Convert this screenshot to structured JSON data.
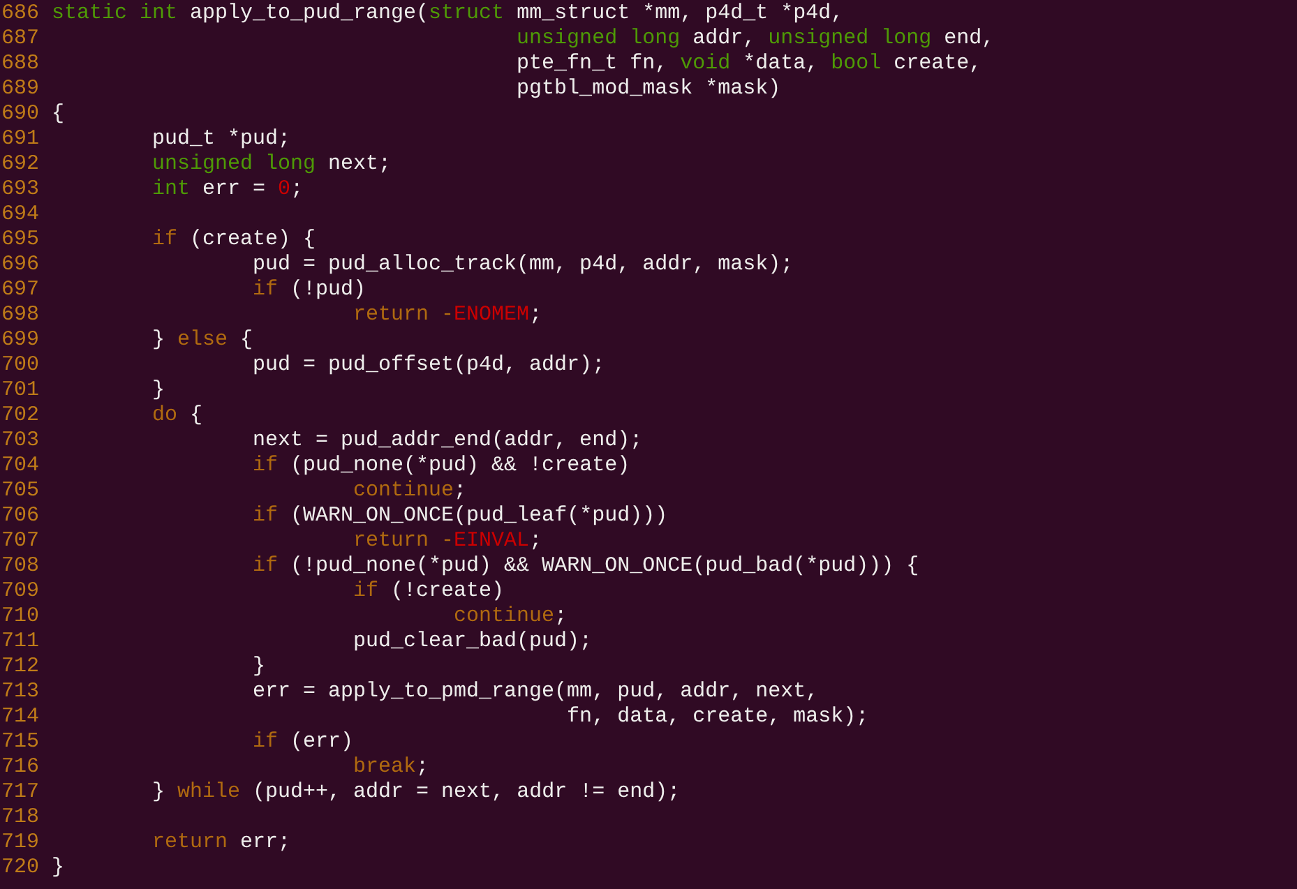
{
  "editor": {
    "lines": [
      {
        "number": "686",
        "segments": [
          {
            "kind": "type",
            "text": "static int"
          },
          {
            "kind": "plain",
            "text": " apply_to_pud_range("
          },
          {
            "kind": "type",
            "text": "struct"
          },
          {
            "kind": "plain",
            "text": " mm_struct *mm, p4d_t *p4d,"
          }
        ]
      },
      {
        "number": "687",
        "segments": [
          {
            "kind": "type",
            "text": "                                     unsigned long"
          },
          {
            "kind": "plain",
            "text": " addr, "
          },
          {
            "kind": "type",
            "text": "unsigned long"
          },
          {
            "kind": "plain",
            "text": " end,"
          }
        ]
      },
      {
        "number": "688",
        "segments": [
          {
            "kind": "plain",
            "text": "                                     pte_fn_t fn, "
          },
          {
            "kind": "type",
            "text": "void"
          },
          {
            "kind": "plain",
            "text": " *data, "
          },
          {
            "kind": "type",
            "text": "bool"
          },
          {
            "kind": "plain",
            "text": " create,"
          }
        ]
      },
      {
        "number": "689",
        "segments": [
          {
            "kind": "plain",
            "text": "                                     pgtbl_mod_mask *mask)"
          }
        ]
      },
      {
        "number": "690",
        "segments": [
          {
            "kind": "plain",
            "text": "{"
          }
        ]
      },
      {
        "number": "691",
        "segments": [
          {
            "kind": "plain",
            "text": "        pud_t *pud;"
          }
        ]
      },
      {
        "number": "692",
        "segments": [
          {
            "kind": "type",
            "text": "        unsigned long"
          },
          {
            "kind": "plain",
            "text": " next;"
          }
        ]
      },
      {
        "number": "693",
        "segments": [
          {
            "kind": "type",
            "text": "        int"
          },
          {
            "kind": "plain",
            "text": " err = "
          },
          {
            "kind": "constant",
            "text": "0"
          },
          {
            "kind": "plain",
            "text": ";"
          }
        ]
      },
      {
        "number": "694"
      },
      {
        "number": "695",
        "segments": [
          {
            "kind": "keyword",
            "text": "        if"
          },
          {
            "kind": "plain",
            "text": " (create) {"
          }
        ]
      },
      {
        "number": "696",
        "segments": [
          {
            "kind": "plain",
            "text": "                pud = pud_alloc_track(mm, p4d, addr, mask);"
          }
        ]
      },
      {
        "number": "697",
        "segments": [
          {
            "kind": "keyword",
            "text": "                if"
          },
          {
            "kind": "plain",
            "text": " (!pud)"
          }
        ]
      },
      {
        "number": "698",
        "segments": [
          {
            "kind": "keyword",
            "text": "                        return -"
          },
          {
            "kind": "constant",
            "text": "ENOMEM"
          },
          {
            "kind": "plain",
            "text": ";"
          }
        ]
      },
      {
        "number": "699",
        "segments": [
          {
            "kind": "plain",
            "text": "        } "
          },
          {
            "kind": "keyword",
            "text": "else"
          },
          {
            "kind": "plain",
            "text": " {"
          }
        ]
      },
      {
        "number": "700",
        "segments": [
          {
            "kind": "plain",
            "text": "                pud = pud_offset(p4d, addr);"
          }
        ]
      },
      {
        "number": "701",
        "segments": [
          {
            "kind": "plain",
            "text": "        }"
          }
        ]
      },
      {
        "number": "702",
        "segments": [
          {
            "kind": "keyword",
            "text": "        do"
          },
          {
            "kind": "plain",
            "text": " {"
          }
        ]
      },
      {
        "number": "703",
        "segments": [
          {
            "kind": "plain",
            "text": "                next = pud_addr_end(addr, end);"
          }
        ]
      },
      {
        "number": "704",
        "segments": [
          {
            "kind": "keyword",
            "text": "                if"
          },
          {
            "kind": "plain",
            "text": " (pud_none(*pud) && !create)"
          }
        ]
      },
      {
        "number": "705",
        "segments": [
          {
            "kind": "keyword",
            "text": "                        continue"
          },
          {
            "kind": "plain",
            "text": ";"
          }
        ]
      },
      {
        "number": "706",
        "segments": [
          {
            "kind": "keyword",
            "text": "                if"
          },
          {
            "kind": "plain",
            "text": " (WARN_ON_ONCE(pud_leaf(*pud)))"
          }
        ]
      },
      {
        "number": "707",
        "segments": [
          {
            "kind": "keyword",
            "text": "                        return -"
          },
          {
            "kind": "constant",
            "text": "EINVAL"
          },
          {
            "kind": "plain",
            "text": ";"
          }
        ]
      },
      {
        "number": "708",
        "segments": [
          {
            "kind": "keyword",
            "text": "                if"
          },
          {
            "kind": "plain",
            "text": " (!pud_none(*pud) && WARN_ON_ONCE(pud_bad(*pud))) {"
          }
        ]
      },
      {
        "number": "709",
        "segments": [
          {
            "kind": "keyword",
            "text": "                        if"
          },
          {
            "kind": "plain",
            "text": " (!create)"
          }
        ]
      },
      {
        "number": "710",
        "segments": [
          {
            "kind": "keyword",
            "text": "                                continue"
          },
          {
            "kind": "plain",
            "text": ";"
          }
        ]
      },
      {
        "number": "711",
        "segments": [
          {
            "kind": "plain",
            "text": "                        pud_clear_bad(pud);"
          }
        ]
      },
      {
        "number": "712",
        "segments": [
          {
            "kind": "plain",
            "text": "                }"
          }
        ]
      },
      {
        "number": "713",
        "segments": [
          {
            "kind": "plain",
            "text": "                err = apply_to_pmd_range(mm, pud, addr, next,"
          }
        ]
      },
      {
        "number": "714",
        "segments": [
          {
            "kind": "plain",
            "text": "                                         fn, data, create, mask);"
          }
        ]
      },
      {
        "number": "715",
        "segments": [
          {
            "kind": "keyword",
            "text": "                if"
          },
          {
            "kind": "plain",
            "text": " (err)"
          }
        ]
      },
      {
        "number": "716",
        "segments": [
          {
            "kind": "keyword",
            "text": "                        break"
          },
          {
            "kind": "plain",
            "text": ";"
          }
        ]
      },
      {
        "number": "717",
        "segments": [
          {
            "kind": "plain",
            "text": "        } "
          },
          {
            "kind": "keyword",
            "text": "while"
          },
          {
            "kind": "plain",
            "text": " (pud++, addr = next, addr != end);"
          }
        ]
      },
      {
        "number": "718"
      },
      {
        "number": "719",
        "segments": [
          {
            "kind": "keyword",
            "text": "        return"
          },
          {
            "kind": "plain",
            "text": " err;"
          }
        ]
      },
      {
        "number": "720",
        "segments": [
          {
            "kind": "plain",
            "text": "}"
          }
        ]
      }
    ]
  }
}
